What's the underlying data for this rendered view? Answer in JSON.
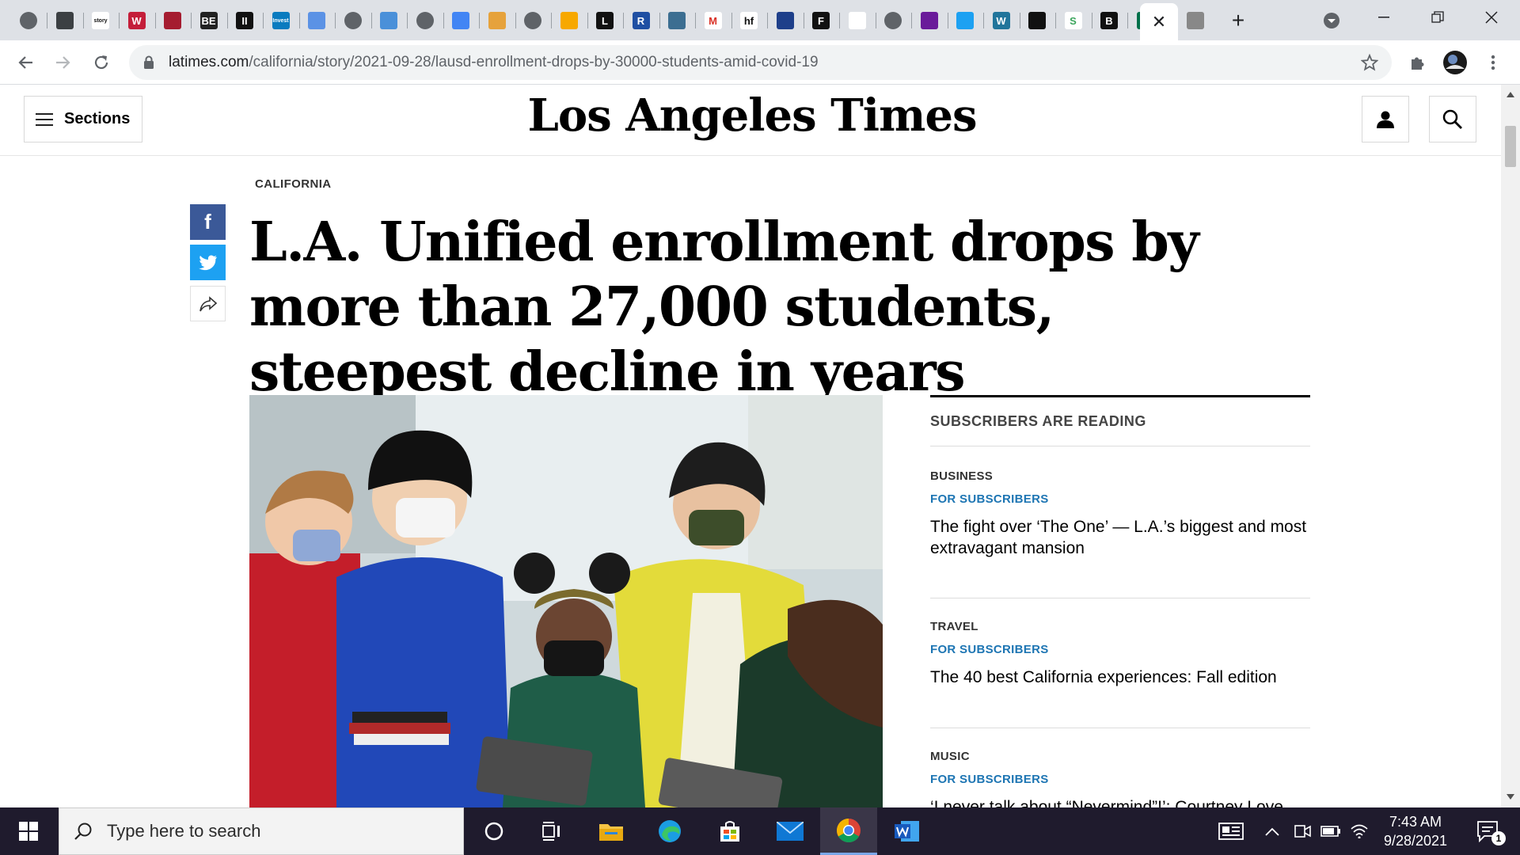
{
  "browser": {
    "url_host": "latimes.com",
    "url_path": "/california/story/2021-09-28/lausd-enrollment-drops-by-30000-students-amid-covid-19",
    "active_tab_close": "✕",
    "new_tab": "+",
    "tabs": [
      {
        "icon": "globe-icon",
        "label": ""
      },
      {
        "icon": "stars-icon",
        "label": ""
      },
      {
        "icon": "story-icon",
        "label": "story"
      },
      {
        "icon": "w-icon",
        "label": "W"
      },
      {
        "icon": "shield-icon",
        "label": ""
      },
      {
        "icon": "be-icon",
        "label": "BE"
      },
      {
        "icon": "ii-icon",
        "label": "II"
      },
      {
        "icon": "invest-icon",
        "label": "Invest"
      },
      {
        "icon": "un-icon",
        "label": ""
      },
      {
        "icon": "globe-icon",
        "label": ""
      },
      {
        "icon": "leaf-icon",
        "label": ""
      },
      {
        "icon": "globe-icon",
        "label": ""
      },
      {
        "icon": "docs-icon",
        "label": ""
      },
      {
        "icon": "cup-icon",
        "label": ""
      },
      {
        "icon": "globe-icon",
        "label": ""
      },
      {
        "icon": "nbc-icon",
        "label": ""
      },
      {
        "icon": "l-icon",
        "label": "L"
      },
      {
        "icon": "r-icon",
        "label": "R"
      },
      {
        "icon": "chat-icon",
        "label": ""
      },
      {
        "icon": "gmail-icon",
        "label": "M"
      },
      {
        "icon": "hf-icon",
        "label": "hf"
      },
      {
        "icon": "pattern-icon",
        "label": ""
      },
      {
        "icon": "f-icon",
        "label": "F"
      },
      {
        "icon": "j-icon",
        "label": ""
      },
      {
        "icon": "globe-icon",
        "label": ""
      },
      {
        "icon": "mail-icon",
        "label": ""
      },
      {
        "icon": "twitter-icon",
        "label": ""
      },
      {
        "icon": "wordpress-icon",
        "label": "W"
      },
      {
        "icon": "slash-icon",
        "label": ""
      },
      {
        "icon": "s-icon",
        "label": "S"
      },
      {
        "icon": "b-icon",
        "label": "B"
      },
      {
        "icon": "starbucks-icon",
        "label": ""
      }
    ]
  },
  "site": {
    "sections_label": "Sections",
    "masthead": "Los Angeles Times"
  },
  "article": {
    "kicker": "CALIFORNIA",
    "headline": "L.A. Unified enrollment drops by more than 27,000 students, steepest decline in years",
    "share_fb": "f"
  },
  "rail": {
    "title": "SUBSCRIBERS ARE READING",
    "items": [
      {
        "section": "BUSINESS",
        "badge": "FOR SUBSCRIBERS",
        "title": "The fight over ‘The One’ — L.A.’s biggest and most extravagant mansion"
      },
      {
        "section": "TRAVEL",
        "badge": "FOR SUBSCRIBERS",
        "title": "The 40 best California experiences: Fall edition"
      },
      {
        "section": "MUSIC",
        "badge": "FOR SUBSCRIBERS",
        "title": "‘I never talk about “Nevermind”!’: Courtney Love"
      }
    ]
  },
  "taskbar": {
    "search_placeholder": "Type here to search",
    "time": "7:43 AM",
    "date": "9/28/2021",
    "notification_count": "1"
  }
}
